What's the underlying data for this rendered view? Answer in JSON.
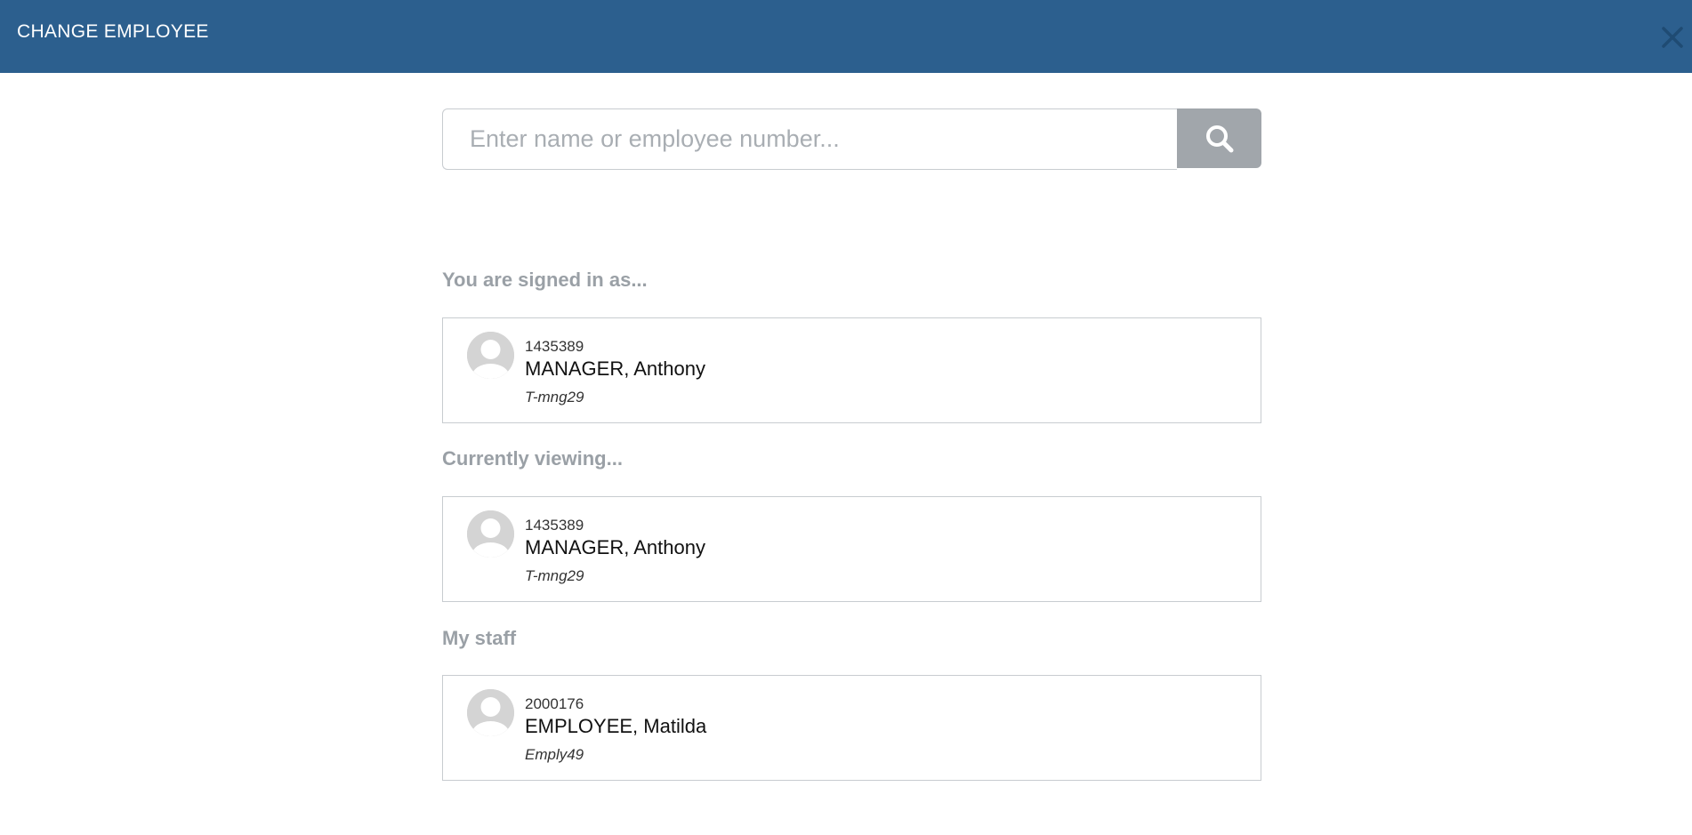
{
  "header": {
    "title": "CHANGE EMPLOYEE",
    "close_icon": "close-icon"
  },
  "search": {
    "placeholder": "Enter name or employee number...",
    "value": "",
    "button_icon": "search-icon"
  },
  "sections": {
    "signed_in_label": "You are signed in as...",
    "viewing_label": "Currently viewing...",
    "staff_label": "My staff"
  },
  "signed_in": {
    "number": "1435389",
    "name": "MANAGER, Anthony",
    "username": "T-mng29"
  },
  "viewing": {
    "number": "1435389",
    "name": "MANAGER, Anthony",
    "username": "T-mng29"
  },
  "staff": [
    {
      "number": "2000176",
      "name": "EMPLOYEE, Matilda",
      "username": "Emply49"
    }
  ],
  "colors": {
    "header_bg": "#2c5f8e",
    "search_button_bg": "#a1a6ab",
    "section_label": "#9aa0a6"
  }
}
